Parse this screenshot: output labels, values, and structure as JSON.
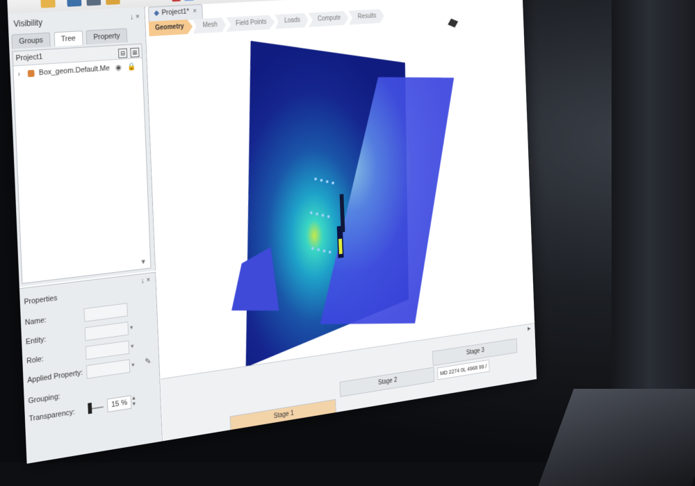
{
  "app": {
    "toolbar": {
      "undo_icon": "undo-icon",
      "redo_icon": "redo-icon"
    }
  },
  "visibility_panel": {
    "title": "Visibility",
    "controls": "↓ ×",
    "tabs": [
      "Groups",
      "Tree",
      "Property"
    ],
    "active_tab": "Tree",
    "tree_root": "Project1",
    "tree_item": "Box_geom.Default.Me"
  },
  "properties_panel": {
    "title": "Properties",
    "controls": "↓ ×",
    "fields": {
      "name_label": "Name:",
      "entity_label": "Entity:",
      "role_label": "Role:",
      "applied_label": "Applied Property:",
      "grouping_label": "Grouping:",
      "transparency_label": "Transparency:",
      "transparency_value": "15 %"
    }
  },
  "document": {
    "tab_label": "Project1*",
    "close": "×",
    "steps": [
      "Geometry",
      "Mesh",
      "Field Points",
      "Loads",
      "Compute",
      "Results"
    ],
    "active_step": "Geometry"
  },
  "stages": {
    "stage3": "Stage 3",
    "stage2": "Stage 2",
    "stage1": "Stage 1",
    "status": "MD 2274 0L 4968 99 /"
  },
  "colors": {
    "active_step": "#f6c98f",
    "plane_dark": "#14208a",
    "plane_light": "#3f48e6"
  }
}
